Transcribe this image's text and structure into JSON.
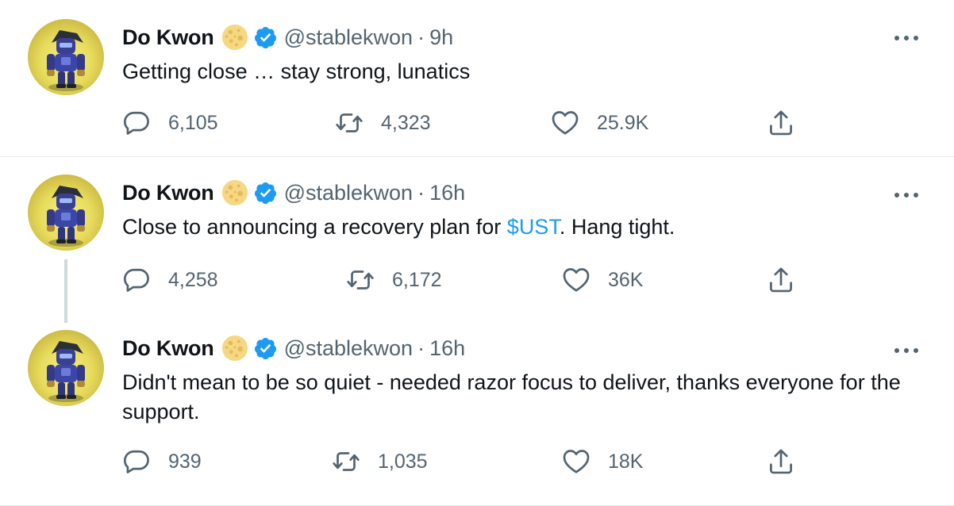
{
  "tweets": [
    {
      "name": "Do Kwon",
      "handle": "@stablekwon",
      "separator": "·",
      "time": "9h",
      "text": "Getting close … stay strong, lunatics",
      "replies": "6,105",
      "retweets": "4,323",
      "likes": "25.9K"
    },
    {
      "name": "Do Kwon",
      "handle": "@stablekwon",
      "separator": "·",
      "time": "16h",
      "text_before": "Close to announcing a recovery plan for ",
      "cashtag": "$UST",
      "text_after": ". Hang tight.",
      "replies": "4,258",
      "retweets": "6,172",
      "likes": "36K"
    },
    {
      "name": "Do Kwon",
      "handle": "@stablekwon",
      "separator": "·",
      "time": "16h",
      "text": "Didn't mean to be so quiet - needed razor focus to deliver, thanks everyone for the support.",
      "replies": "939",
      "retweets": "1,035",
      "likes": "18K"
    }
  ],
  "colors": {
    "secondary_text": "#536471",
    "link": "#1d9bf0",
    "verified": "#1d9bf0",
    "divider": "#e6e9eb",
    "thread_line": "#cfd9de"
  },
  "icons": [
    "moon-emoji-icon",
    "verified-badge-icon",
    "more-options-icon",
    "reply-icon",
    "retweet-icon",
    "like-icon",
    "share-icon"
  ]
}
